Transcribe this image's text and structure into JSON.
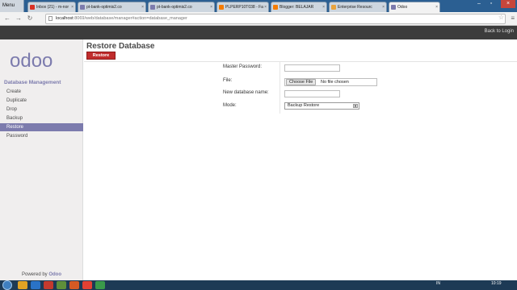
{
  "browser": {
    "menu_label": "Menu",
    "tabs": [
      {
        "label": "Inbox (21) - m-nor",
        "favicon_color": "#d93025",
        "active": false
      },
      {
        "label": "pt-bank-optimis2.co",
        "favicon_color": "#7c7bad",
        "active": false
      },
      {
        "label": "pt-bank-optimis2.co",
        "favicon_color": "#7c7bad",
        "active": false
      },
      {
        "label": "PLPERP10T038 - Fa",
        "favicon_color": "#f57c00",
        "active": false
      },
      {
        "label": "Blogger: BELAJAR",
        "favicon_color": "#f57c00",
        "active": false
      },
      {
        "label": "Enterprise Resourc",
        "favicon_color": "#e8a33d",
        "active": false
      },
      {
        "label": "Odoo",
        "favicon_color": "#7c7bad",
        "active": true
      }
    ],
    "url_host": "localhost",
    "url_rest": ":8069/web/database/manager#action=database_manager"
  },
  "odoo": {
    "back_to_login": "Back to Login",
    "logo_text": "odoo",
    "section_title": "Database Management",
    "menu": [
      "Create",
      "Duplicate",
      "Drop",
      "Backup",
      "Restore",
      "Password"
    ],
    "active_menu": "Restore",
    "powered_prefix": "Powered by",
    "powered_brand": "Odoo",
    "page_title": "Restore Database",
    "restore_button": "Restore",
    "form": {
      "master_password_label": "Master Password:",
      "file_label": "File:",
      "file_button": "Choose File",
      "file_status": "No file chosen",
      "new_db_label": "New database name:",
      "mode_label": "Mode:",
      "mode_value": "Backup Restore"
    }
  },
  "taskbar": {
    "lang": "IN",
    "time": "10:19"
  },
  "colors": {
    "brand": "#7c7bad",
    "restore_red": "#c02c2c",
    "topbar": "#3c3c3c"
  }
}
